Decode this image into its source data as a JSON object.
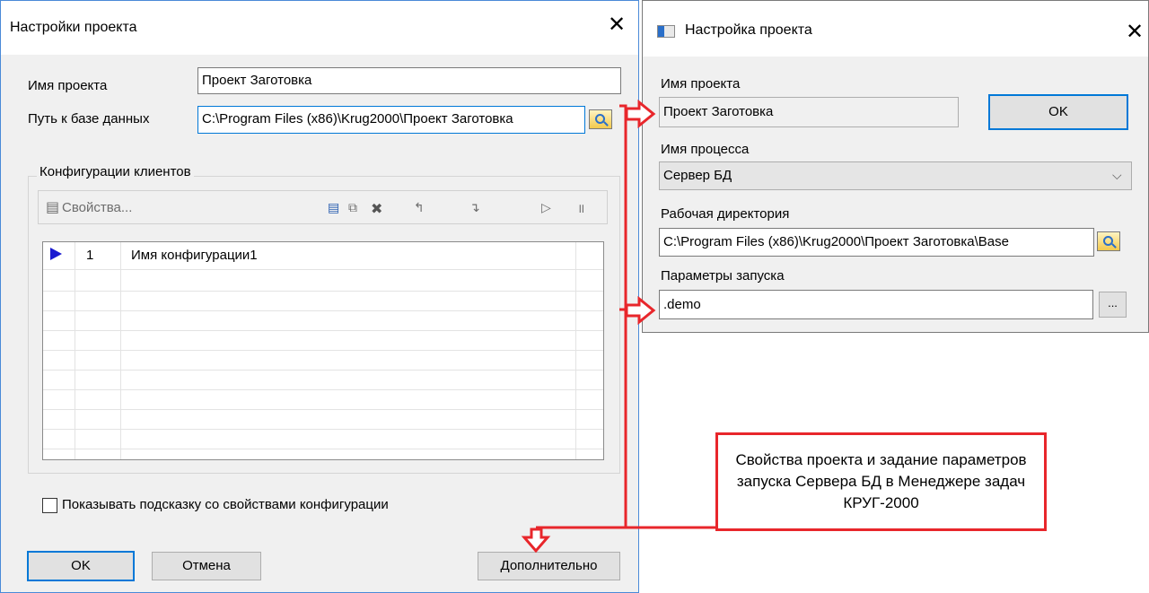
{
  "left_dialog": {
    "title": "Настройки проекта",
    "project_name_label": "Имя проекта",
    "project_name_value": "Проект Заготовка",
    "db_path_label": "Путь к базе данных",
    "db_path_value": "C:\\Program Files (x86)\\Krug2000\\Проект Заготовка",
    "client_configs_label": "Конфигурации клиентов",
    "properties_button": "Свойства...",
    "configs_table": {
      "rows": [
        {
          "num": "1",
          "name": "Имя конфигурации1"
        }
      ]
    },
    "show_hint_checkbox": "Показывать подсказку со свойствами конфигурации",
    "ok_button": "OK",
    "cancel_button": "Отмена",
    "advanced_button": "Дополнительно"
  },
  "right_dialog": {
    "title": "Настройка проекта",
    "project_name_label": "Имя проекта",
    "project_name_value": "Проект Заготовка",
    "ok_button": "OK",
    "process_name_label": "Имя процесса",
    "process_name_value": "Сервер БД",
    "work_dir_label": "Рабочая директория",
    "work_dir_value": "C:\\Program Files (x86)\\Krug2000\\Проект Заготовка\\Base",
    "launch_params_label": "Параметры запуска",
    "launch_params_value": ".demo",
    "more_button": "..."
  },
  "annotation": {
    "text": "Свойства проекта и задание параметров запуска Сервера БД в Менеджере задач КРУГ-2000"
  },
  "colors": {
    "accent": "#0078d7",
    "annotation_red": "#e8262b"
  }
}
